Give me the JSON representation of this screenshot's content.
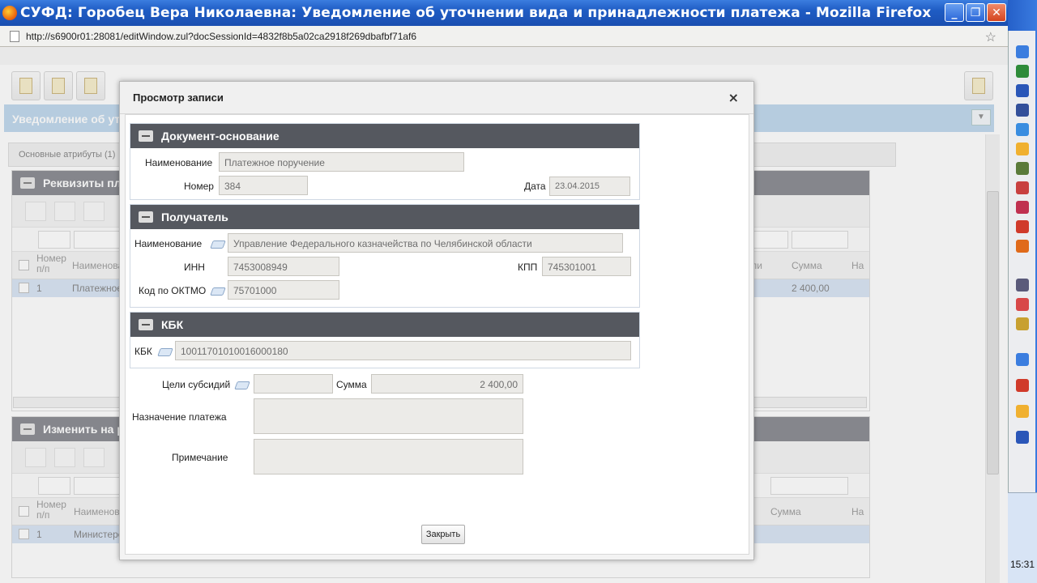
{
  "window": {
    "title": "СУФД: Горобец Вера Николаевна: Уведомление об уточнении вида и принадлежности платежа - Mozilla Firefox",
    "url": "http://s6900r01:28081/editWindow.zul?docSessionId=4832f8b5a02ca2918f269dbafbf71af6",
    "minimize": "_",
    "maximize": "❐",
    "close": "✕"
  },
  "background": {
    "header": "Уведомление об уточ",
    "tab": "Основные атрибуты (1)",
    "panel1": {
      "title": "Реквизиты пла",
      "col_num": "Номер п/п",
      "col_name": "Наименова",
      "col_ely": "ели",
      "col_sum": "Сумма",
      "col_na": "На",
      "row_num": "1",
      "row_name": "Платежное",
      "row_sum": "2 400,00"
    },
    "panel2": {
      "title": "Изменить на р",
      "col_num": "Номер п/п",
      "col_name": "Наименова",
      "col_sum": "Сумма",
      "col_na": "На",
      "row_num": "1",
      "row_name": "Министерст"
    }
  },
  "clock": "15:31",
  "modal": {
    "title": "Просмотр записи",
    "close_glyph": "×",
    "doc_section": {
      "title": "Документ-основание",
      "name_label": "Наименование",
      "name_value": "Платежное поручение",
      "number_label": "Номер",
      "number_value": "384",
      "date_label": "Дата",
      "date_value": "23.04.2015"
    },
    "recipient_section": {
      "title": "Получатель",
      "name_label": "Наименование",
      "name_value": "Управление Федерального казначейства по Челябинской области",
      "inn_label": "ИНН",
      "inn_value": "7453008949",
      "kpp_label": "КПП",
      "kpp_value": "745301001",
      "oktmo_label": "Код по ОКТМО",
      "oktmo_value": "75701000"
    },
    "kbk_section": {
      "title": "КБК",
      "kbk_label": "КБК",
      "kbk_value": "10011701010016000180"
    },
    "subsidy_label": "Цели субсидий",
    "subsidy_value": "",
    "sum_label": "Сумма",
    "sum_value": "2 400,00",
    "purpose_label": "Назначение платежа",
    "purpose_value": "",
    "note_label": "Примечание",
    "note_value": "",
    "close_button": "Закрыть"
  }
}
